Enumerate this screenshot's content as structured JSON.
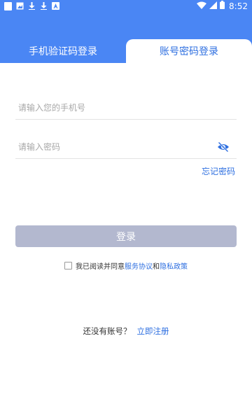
{
  "colors": {
    "primary": "#4a86f4",
    "link": "#2e6fe0",
    "button_disabled": "#b3b8cf"
  },
  "status_bar": {
    "time": "8:52",
    "icons": [
      "app-square-icon",
      "image-icon",
      "download-icon",
      "download-icon",
      "font-icon",
      "wifi-icon",
      "signal-icon",
      "battery-icon"
    ]
  },
  "tabs": {
    "sms_login": "手机验证码登录",
    "password_login": "账号密码登录",
    "active": "password_login"
  },
  "form": {
    "phone_placeholder": "请输入您的手机号",
    "phone_value": "",
    "password_placeholder": "请输入密码",
    "password_value": "",
    "password_toggle_icon": "eye-off-icon",
    "forgot_password": "忘记密码"
  },
  "login_button": "登录",
  "agreement": {
    "checked": false,
    "prefix": "我已阅读并同意",
    "service_link": "服务协议",
    "and": "和",
    "privacy_link": "隐私政策"
  },
  "register": {
    "prompt": "还没有账号？",
    "link": "立即注册"
  }
}
